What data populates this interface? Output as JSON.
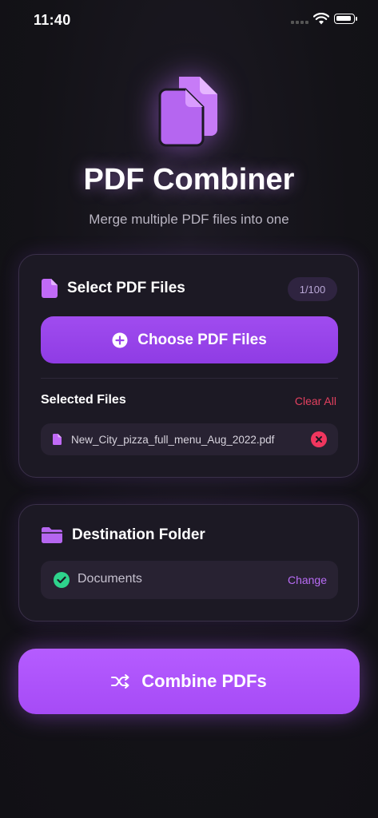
{
  "status_bar": {
    "time": "11:40"
  },
  "header": {
    "icon": "documents-icon",
    "title": "PDF Combiner",
    "subtitle": "Merge multiple PDF files into one"
  },
  "select_card": {
    "icon": "document-icon",
    "title": "Select PDF Files",
    "count_badge": "1/100",
    "choose_button": {
      "icon": "plus-circle-icon",
      "label": "Choose PDF Files"
    },
    "selected_label": "Selected Files",
    "clear_all": "Clear All",
    "files": [
      {
        "icon": "pdf-file-icon",
        "name": "New_City_pizza_full_menu_Aug_2022.pdf"
      }
    ]
  },
  "destination_card": {
    "icon": "folder-icon",
    "title": "Destination Folder",
    "folder": "Documents",
    "change_label": "Change"
  },
  "combine_button": {
    "icon": "shuffle-icon",
    "label": "Combine PDFs"
  },
  "colors": {
    "accent": "#a64bf6",
    "accent_button": "#9a46ec",
    "danger": "#f0365e",
    "success": "#2ed38c",
    "background": "#131217",
    "card": "#1c1924"
  }
}
